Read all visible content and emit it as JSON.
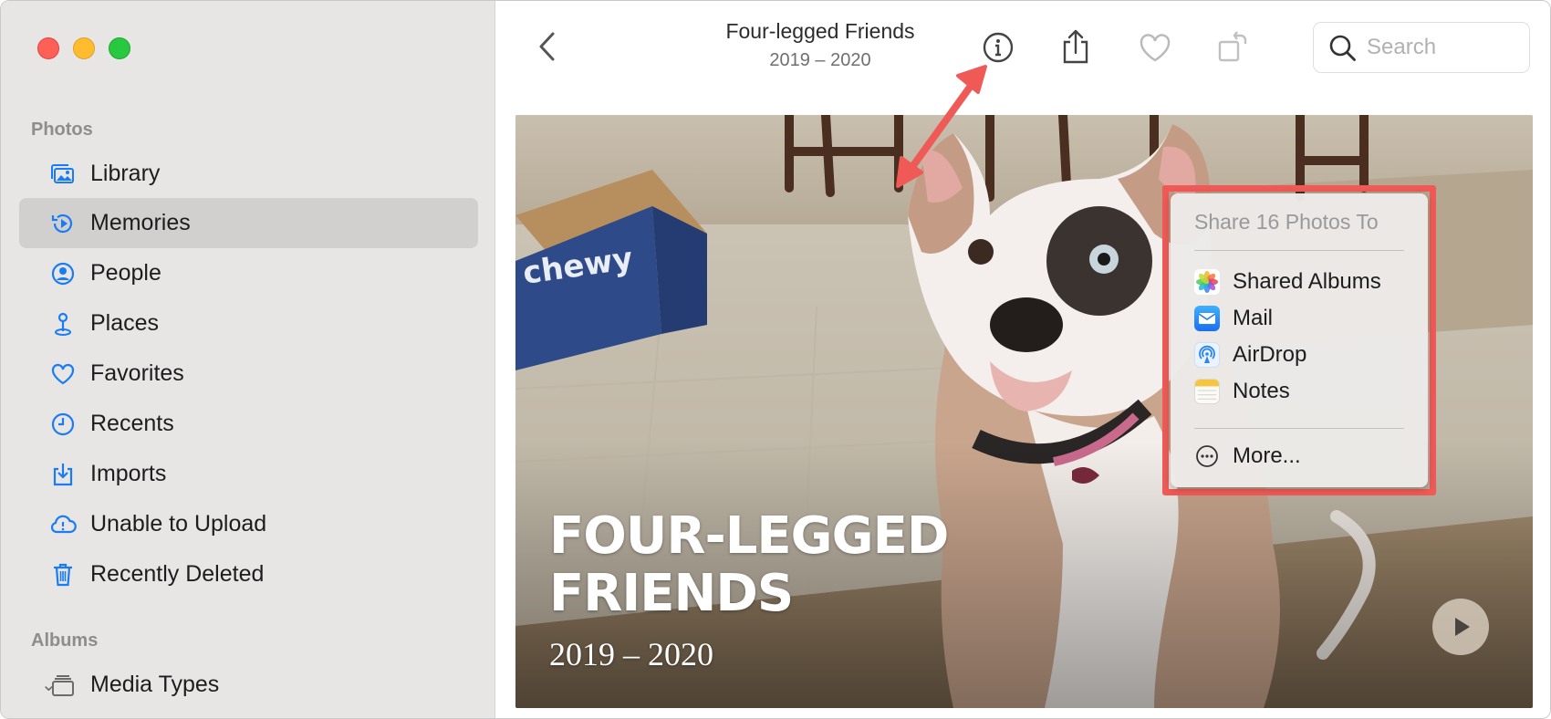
{
  "sidebar": {
    "sections": {
      "photos": "Photos",
      "albums": "Albums"
    },
    "items": [
      {
        "label": "Library",
        "icon": "library-icon"
      },
      {
        "label": "Memories",
        "icon": "memories-icon",
        "selected": true
      },
      {
        "label": "People",
        "icon": "people-icon"
      },
      {
        "label": "Places",
        "icon": "places-icon"
      },
      {
        "label": "Favorites",
        "icon": "heart-icon"
      },
      {
        "label": "Recents",
        "icon": "clock-icon"
      },
      {
        "label": "Imports",
        "icon": "import-icon"
      },
      {
        "label": "Unable to Upload",
        "icon": "cloud-alert-icon"
      },
      {
        "label": "Recently Deleted",
        "icon": "trash-icon"
      }
    ],
    "albums": [
      {
        "label": "Media Types",
        "icon": "stack-icon"
      }
    ]
  },
  "header": {
    "title": "Four-legged Friends",
    "subtitle": "2019 – 2020",
    "search_placeholder": "Search"
  },
  "photo": {
    "caption_title": "FOUR-LEGGED\nFRIENDS",
    "caption_date": "2019 – 2020"
  },
  "share_menu": {
    "heading": "Share 16 Photos To",
    "items": [
      {
        "label": "Shared Albums",
        "icon": "shared-albums-icon"
      },
      {
        "label": "Mail",
        "icon": "mail-icon"
      },
      {
        "label": "AirDrop",
        "icon": "airdrop-icon"
      },
      {
        "label": "Notes",
        "icon": "notes-icon"
      }
    ],
    "more_label": "More..."
  },
  "colors": {
    "accent": "#1a7cf5",
    "highlight": "#ef5a57",
    "sidebar_bg": "#e8e6e4",
    "sidebar_selected": "#d2d0ce"
  }
}
